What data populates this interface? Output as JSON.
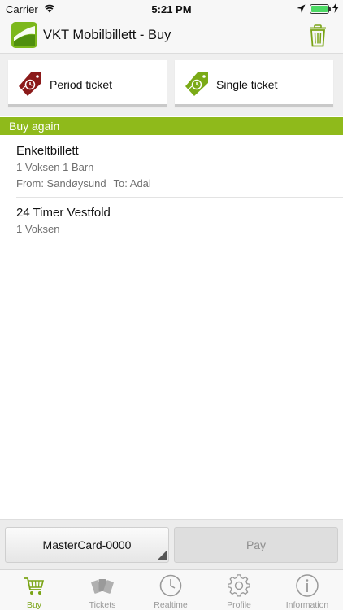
{
  "status_bar": {
    "carrier": "Carrier",
    "time": "5:21 PM"
  },
  "header": {
    "title": "VKT Mobilbillett - Buy"
  },
  "ticket_types": [
    {
      "label": "Period ticket",
      "icon": "tag-clock-icon",
      "color": "#8b1a1a"
    },
    {
      "label": "Single ticket",
      "icon": "tag-clock-icon",
      "color": "#7aaa16"
    }
  ],
  "buy_again": {
    "header": "Buy again",
    "items": [
      {
        "title": "Enkeltbillett",
        "passengers": "1 Voksen 1 Barn",
        "from": "From: Sandøysund",
        "to": "To: Adal"
      },
      {
        "title": "24 Timer Vestfold",
        "passengers": "1 Voksen"
      }
    ]
  },
  "payment": {
    "card": "MasterCard-0000",
    "pay_label": "Pay"
  },
  "tabs": [
    {
      "label": "Buy",
      "icon": "cart-icon",
      "active": true
    },
    {
      "label": "Tickets",
      "icon": "tickets-icon",
      "active": false
    },
    {
      "label": "Realtime",
      "icon": "clock-icon",
      "active": false
    },
    {
      "label": "Profile",
      "icon": "gear-icon",
      "active": false
    },
    {
      "label": "Information",
      "icon": "info-icon",
      "active": false
    }
  ],
  "colors": {
    "accent": "#8fba1b",
    "accent_dark": "#7aa416",
    "period_tag": "#8b1a1a"
  }
}
